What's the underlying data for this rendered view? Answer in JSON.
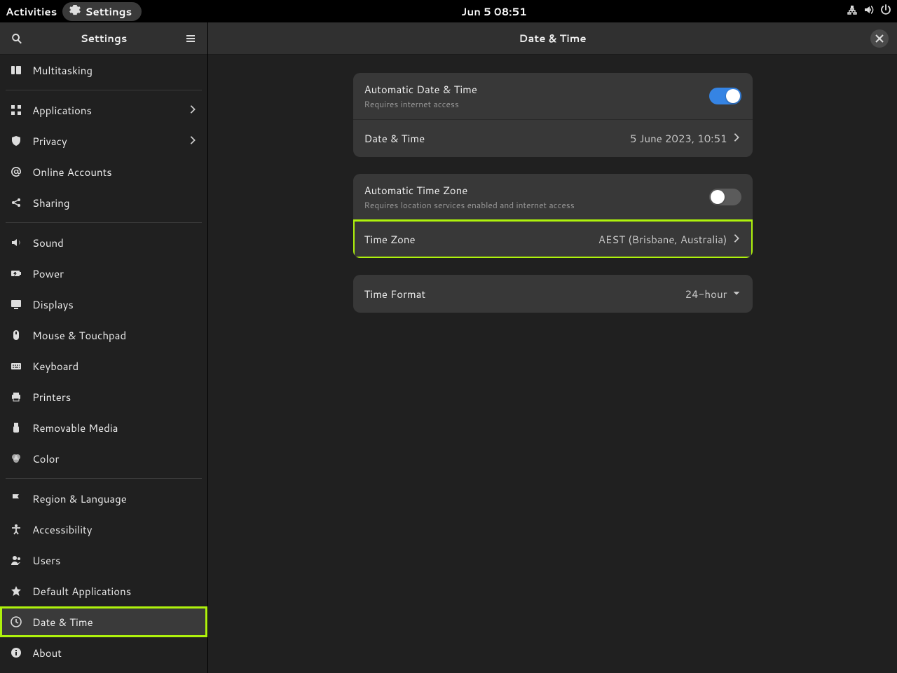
{
  "topbar": {
    "activities": "Activities",
    "app_label": "Settings",
    "clock": "Jun 5  08:51"
  },
  "sidebar": {
    "title": "Settings",
    "items": [
      {
        "id": "multitasking",
        "label": "Multitasking",
        "icon": "multitasking",
        "sep_after": true
      },
      {
        "id": "applications",
        "label": "Applications",
        "icon": "apps",
        "chevron": true
      },
      {
        "id": "privacy",
        "label": "Privacy",
        "icon": "privacy",
        "chevron": true
      },
      {
        "id": "online-accounts",
        "label": "Online Accounts",
        "icon": "at"
      },
      {
        "id": "sharing",
        "label": "Sharing",
        "icon": "share",
        "sep_after": true
      },
      {
        "id": "sound",
        "label": "Sound",
        "icon": "sound"
      },
      {
        "id": "power",
        "label": "Power",
        "icon": "power"
      },
      {
        "id": "displays",
        "label": "Displays",
        "icon": "display"
      },
      {
        "id": "mouse",
        "label": "Mouse & Touchpad",
        "icon": "mouse"
      },
      {
        "id": "keyboard",
        "label": "Keyboard",
        "icon": "keyboard"
      },
      {
        "id": "printers",
        "label": "Printers",
        "icon": "printer"
      },
      {
        "id": "removable",
        "label": "Removable Media",
        "icon": "usb"
      },
      {
        "id": "color",
        "label": "Color",
        "icon": "color",
        "sep_after": true
      },
      {
        "id": "region",
        "label": "Region & Language",
        "icon": "flag"
      },
      {
        "id": "accessibility",
        "label": "Accessibility",
        "icon": "a11y"
      },
      {
        "id": "users",
        "label": "Users",
        "icon": "users"
      },
      {
        "id": "default-apps",
        "label": "Default Applications",
        "icon": "star"
      },
      {
        "id": "date-time",
        "label": "Date & Time",
        "icon": "clock",
        "selected": true,
        "highlight": true
      },
      {
        "id": "about",
        "label": "About",
        "icon": "info"
      }
    ]
  },
  "main": {
    "title": "Date & Time",
    "groups": [
      {
        "rows": [
          {
            "id": "auto-datetime",
            "title": "Automatic Date & Time",
            "sub": "Requires internet access",
            "control": "switch",
            "on": true
          },
          {
            "id": "datetime",
            "title": "Date & Time",
            "value": "5 June 2023, 10:51",
            "control": "chevron"
          }
        ]
      },
      {
        "rows": [
          {
            "id": "auto-tz",
            "title": "Automatic Time Zone",
            "sub": "Requires location services enabled and internet access",
            "control": "switch",
            "on": false
          },
          {
            "id": "timezone",
            "title": "Time Zone",
            "value": "AEST (Brisbane, Australia)",
            "control": "chevron",
            "highlight": true
          }
        ]
      },
      {
        "rows": [
          {
            "id": "time-format",
            "title": "Time Format",
            "value": "24-hour",
            "control": "caret"
          }
        ]
      }
    ]
  }
}
